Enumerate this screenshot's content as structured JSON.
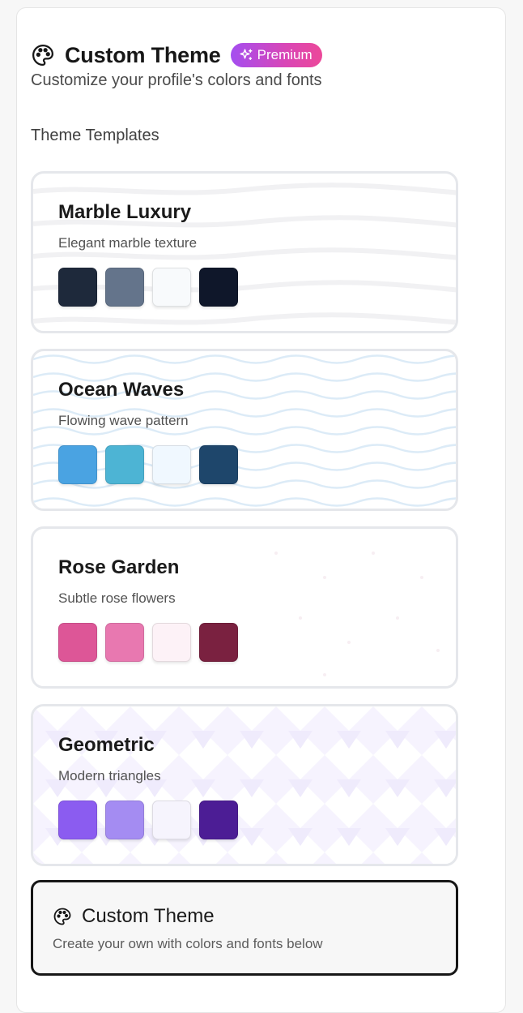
{
  "header": {
    "title": "Custom Theme",
    "badge": "Premium",
    "subtitle": "Customize your profile's colors and fonts",
    "icon": "palette-icon",
    "badge_icon": "sparkles-icon"
  },
  "templates_label": "Theme Templates",
  "templates": [
    {
      "name": "Marble Luxury",
      "description": "Elegant marble texture",
      "pattern": "marble",
      "colors": [
        "#1e293b",
        "#64748b",
        "#f8fafc",
        "#0f172a"
      ]
    },
    {
      "name": "Ocean Waves",
      "description": "Flowing wave pattern",
      "pattern": "waves",
      "colors": [
        "#4aa3e2",
        "#4db4d4",
        "#f0f8ff",
        "#1e466b"
      ]
    },
    {
      "name": "Rose Garden",
      "description": "Subtle rose flowers",
      "pattern": "roses",
      "colors": [
        "#dd5697",
        "#e878b0",
        "#fdf2f7",
        "#7a2140"
      ]
    },
    {
      "name": "Geometric",
      "description": "Modern triangles",
      "pattern": "triangles",
      "colors": [
        "#8b5cf0",
        "#a48cf2",
        "#f6f4fd",
        "#4c1d95"
      ]
    }
  ],
  "custom": {
    "title": "Custom Theme",
    "description": "Create your own with colors and fonts below",
    "icon": "palette-icon",
    "selected": true
  }
}
